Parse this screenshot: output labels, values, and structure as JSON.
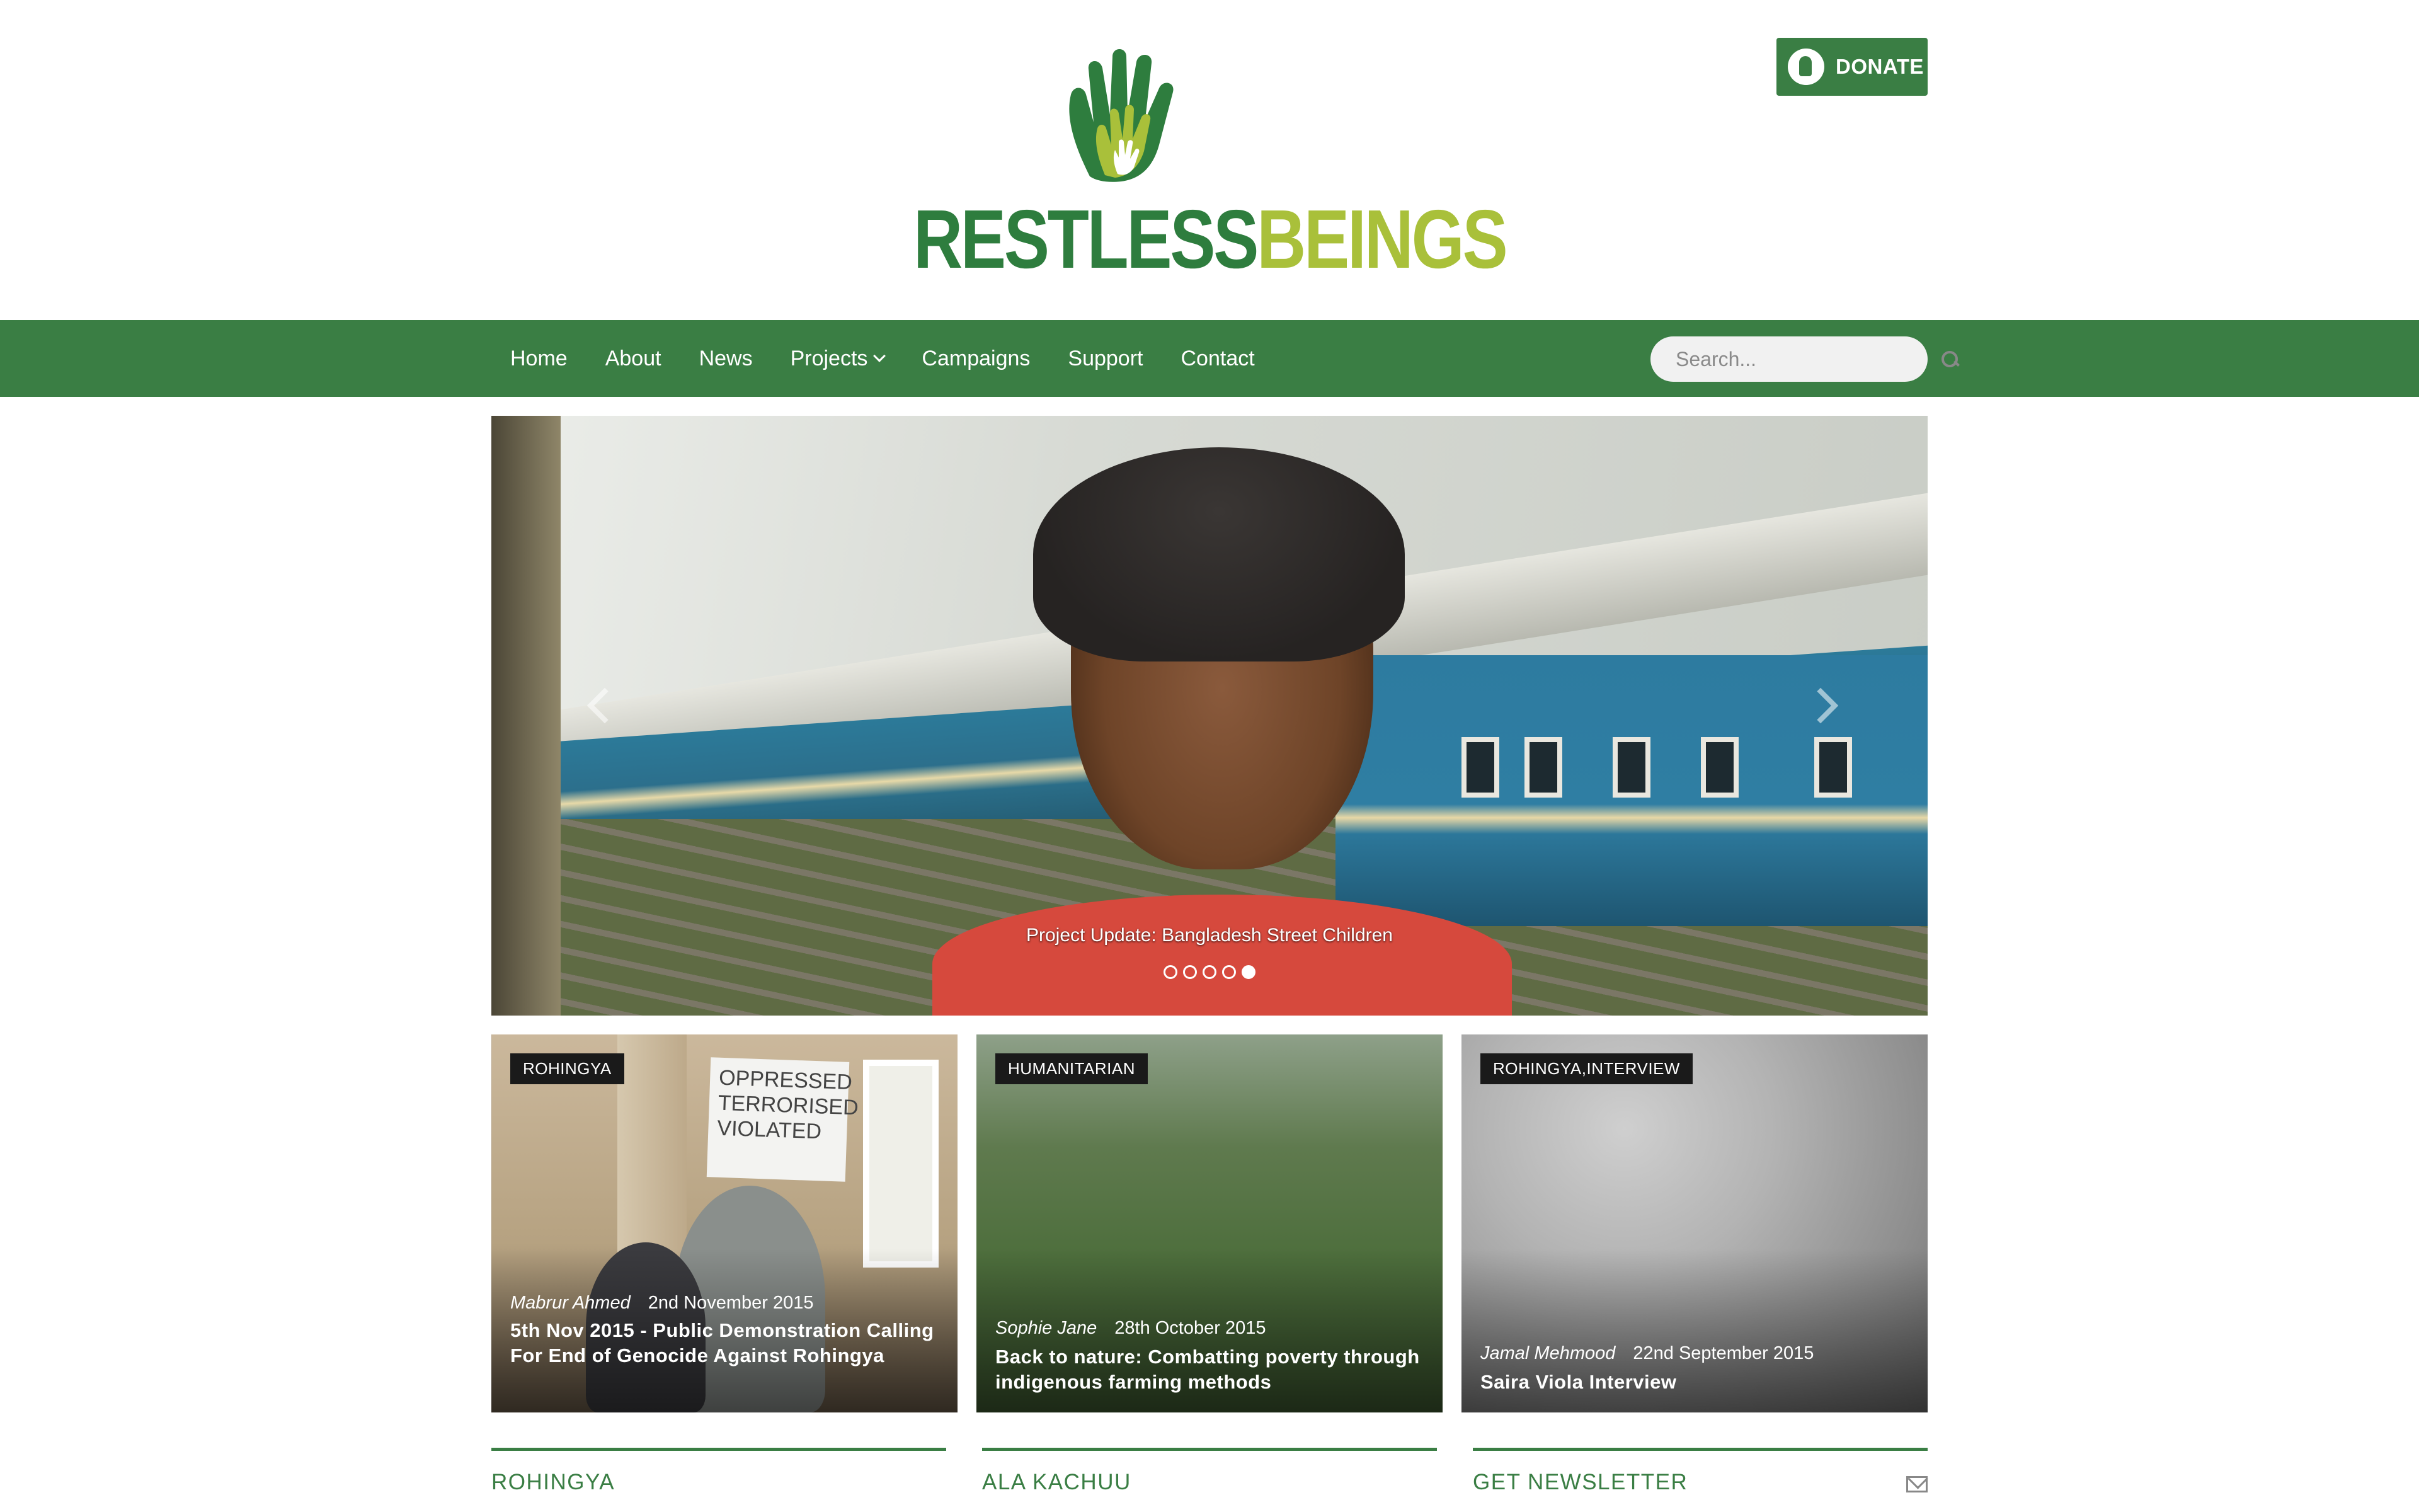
{
  "brand": {
    "name_part1": "RESTLESS",
    "name_part2": "BEINGS",
    "logo_icon": "hand-logo-icon",
    "colors": {
      "primary_green": "#3a7e44",
      "dark_green": "#2e7d3e",
      "lime": "#a9c03a"
    }
  },
  "header": {
    "donate_label": "DONATE",
    "donate_icon": "globe-person-icon"
  },
  "nav": {
    "items": [
      {
        "label": "Home"
      },
      {
        "label": "About"
      },
      {
        "label": "News"
      },
      {
        "label": "Projects",
        "has_dropdown": true
      },
      {
        "label": "Campaigns"
      },
      {
        "label": "Support"
      },
      {
        "label": "Contact"
      }
    ],
    "search_placeholder": "Search..."
  },
  "hero": {
    "caption": "Project Update: Bangladesh Street Children",
    "slide_count": 5,
    "active_slide": 5
  },
  "cards": [
    {
      "tag": "ROHINGYA",
      "author": "Mabrur Ahmed",
      "date": "2nd November 2015",
      "title": "5th Nov 2015 - Public Demonstration Calling For End of Genocide Against Rohingya",
      "sign_text": [
        "OPPRESSED",
        "TERRORISED",
        "VIOLATED"
      ]
    },
    {
      "tag": "HUMANITARIAN",
      "author": "Sophie Jane",
      "date": "28th October 2015",
      "title": "Back to nature: Combatting poverty through indigenous farming methods"
    },
    {
      "tag": "ROHINGYA,INTERVIEW",
      "author": "Jamal Mehmood",
      "date": "22nd September 2015",
      "title": "Saira Viola Interview"
    }
  ],
  "sections": [
    {
      "title": "ROHINGYA"
    },
    {
      "title": "ALA KACHUU"
    },
    {
      "title": "GET NEWSLETTER",
      "icon": "envelope-icon"
    }
  ]
}
